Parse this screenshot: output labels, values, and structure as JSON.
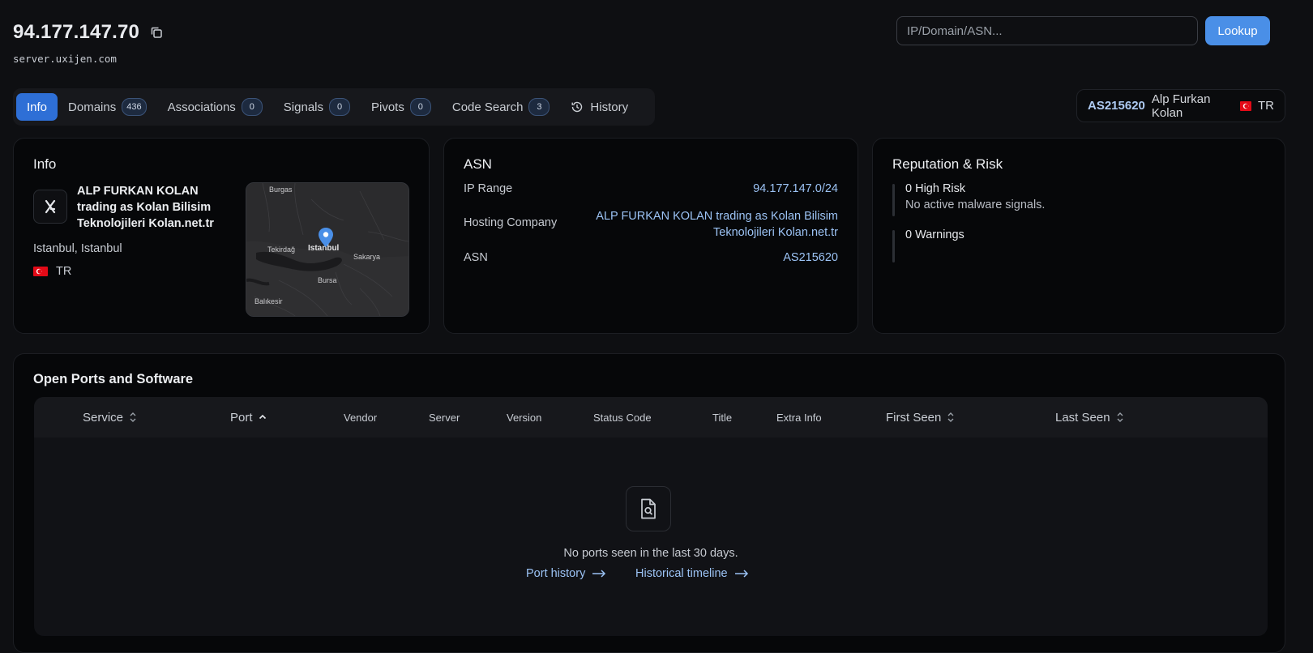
{
  "header": {
    "ip": "94.177.147.70",
    "hostname": "server.uxijen.com",
    "search_placeholder": "IP/Domain/ASN...",
    "lookup_label": "Lookup"
  },
  "tabs": [
    {
      "label": "Info",
      "active": true
    },
    {
      "label": "Domains",
      "count": "436"
    },
    {
      "label": "Associations",
      "count": "0"
    },
    {
      "label": "Signals",
      "count": "0"
    },
    {
      "label": "Pivots",
      "count": "0"
    },
    {
      "label": "Code Search",
      "count": "3"
    },
    {
      "label": "History",
      "icon": "history-icon"
    }
  ],
  "asn_chip": {
    "asn": "AS215620",
    "name": "Alp Furkan Kolan",
    "country": "TR"
  },
  "info_card": {
    "title": "Info",
    "org_name": "ALP FURKAN KOLAN trading as Kolan Bilisim Teknolojileri Kolan.net.tr",
    "city": "Istanbul, Istanbul",
    "country": "TR",
    "map_labels": {
      "burgas": "Burgas",
      "tekirdag": "Tekirdağ",
      "istanbul": "Istanbul",
      "sakarya": "Sakarya",
      "bursa": "Bursa",
      "balikesir": "Balıkesir"
    }
  },
  "asn_card": {
    "title": "ASN",
    "rows": [
      {
        "label": "IP Range",
        "value": "94.177.147.0/24"
      },
      {
        "label": "Hosting Company",
        "value": "ALP FURKAN KOLAN trading as Kolan Bilisim Teknolojileri Kolan.net.tr"
      },
      {
        "label": "ASN",
        "value": "AS215620"
      }
    ]
  },
  "reputation_card": {
    "title": "Reputation & Risk",
    "high_risk": "0 High Risk",
    "high_risk_note": "No active malware signals.",
    "warnings": "0 Warnings"
  },
  "ports": {
    "title": "Open Ports and Software",
    "columns": [
      "Service",
      "Port",
      "Vendor",
      "Server",
      "Version",
      "Status Code",
      "Title",
      "Extra Info",
      "First Seen",
      "Last Seen"
    ],
    "empty_text": "No ports seen in the last 30 days.",
    "port_history_link": "Port history",
    "timeline_link": "Historical timeline"
  },
  "colors": {
    "accent": "#4a8fe7",
    "active_tab": "#2e6fd6",
    "link": "#9cc3f5",
    "background": "#0e0f12"
  }
}
